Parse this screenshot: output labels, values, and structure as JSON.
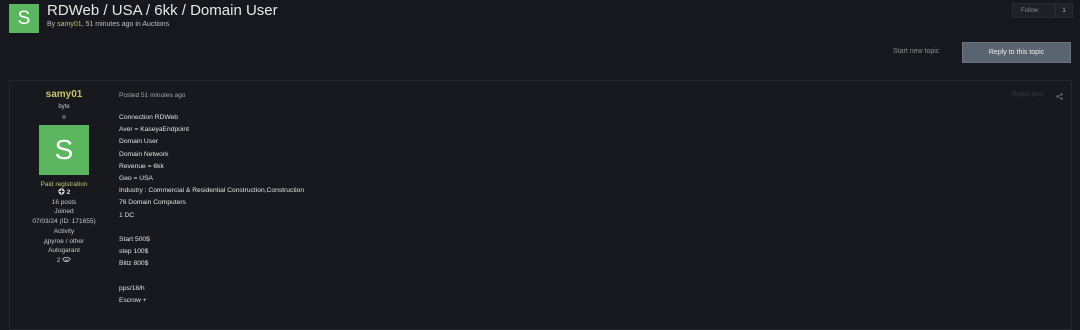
{
  "topic": {
    "avatar_letter": "S",
    "title": "RDWeb / USA / 6kk / Domain User",
    "meta_prefix": "By ",
    "author": "samy01",
    "meta_suffix": ", 51 minutes ago in Auctions"
  },
  "follow": {
    "label": "Follow",
    "count": "1"
  },
  "actions": {
    "start_new_topic": "Start new topic",
    "reply": "Reply to this topic"
  },
  "post": {
    "author": {
      "name": "samy01",
      "title": "byte",
      "avatar_letter": "S",
      "group": "Paid registration",
      "reputation": "2",
      "posts": "16 posts",
      "joined_label": "Joined",
      "joined_value": "07/03/24 (ID: 171655)",
      "activity_label": "Activity",
      "activity_value": "другое / other",
      "autogarant_label": "Autogarant",
      "autogarant_value": "2"
    },
    "posted": "Posted 51 minutes ago",
    "report": "Report post",
    "lines": [
      "Connection RDWeb",
      "Aver = KaseyaEndpoint",
      "Domain User",
      "Domain Network",
      "Revenue = 6kk",
      "Geo = USA",
      "Industry : Commercial & Residential Construction,Construction",
      "76 Domain Computers",
      "1 DC",
      "",
      "Start 500$",
      "step 100$",
      "Blitz 800$",
      "",
      "pps/18/h",
      "Escrow +"
    ]
  },
  "colors": {
    "background": "#17181d",
    "avatar_green": "#5cb65f",
    "author_yellow": "#c7c36b",
    "reply_button": "#5a6470"
  }
}
